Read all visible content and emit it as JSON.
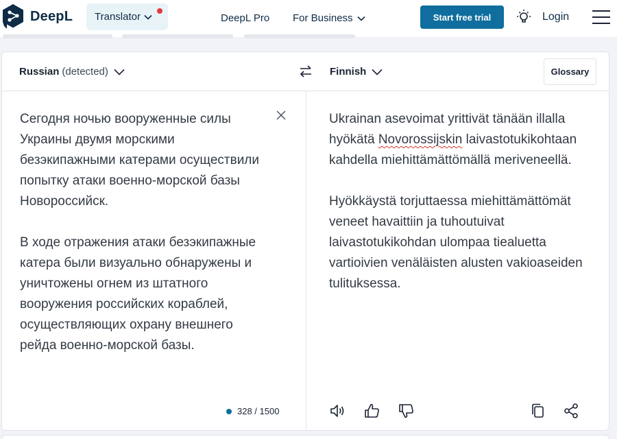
{
  "header": {
    "brand": "DeepL",
    "translator_label": "Translator",
    "nav_pro": "DeepL Pro",
    "nav_business": "For Business",
    "trial_button": "Start free trial",
    "login": "Login"
  },
  "translator": {
    "source_language": "Russian",
    "source_detected": "(detected)",
    "target_language": "Finnish",
    "glossary_button": "Glossary",
    "source_text": "Сегодня ночью вооруженные силы Украины двумя морскими безэкипажными катерами осуществили попытку атаки военно-морской базы Новороссийск.\n\nВ ходе отражения атаки безэкипажные катера были визуально обнаружены и уничтожены огнем из штатного вооружения российских кораблей, осуществляющих охрану внешнего рейда военно-морской базы.",
    "target_text_before": "Ukrainan asevoimat yrittivät tänään illalla hyökätä ",
    "target_text_flagged": "Novorossijskin",
    "target_text_after": " laivastotukikohtaan kahdella miehittämättömällä meriveneellä.\n\nHyökkäystä torjuttaessa miehittämättömät veneet havaittiin ja tuhoutuivat laivastotukikohdan ulompaa tiealuetta vartioivien venäläisten alusten vakioaseiden tulituksessa.",
    "char_count": "328 / 1500"
  },
  "icons": {
    "logo": "deepl-logo-icon",
    "speaker": "speaker-icon",
    "thumbs_up": "thumbs-up-icon",
    "thumbs_down": "thumbs-down-icon",
    "copy": "copy-icon",
    "share": "share-icon"
  },
  "colors": {
    "accent": "#0f6e9e",
    "brand_dark": "#0f2b46",
    "notification": "#e23b3b"
  }
}
